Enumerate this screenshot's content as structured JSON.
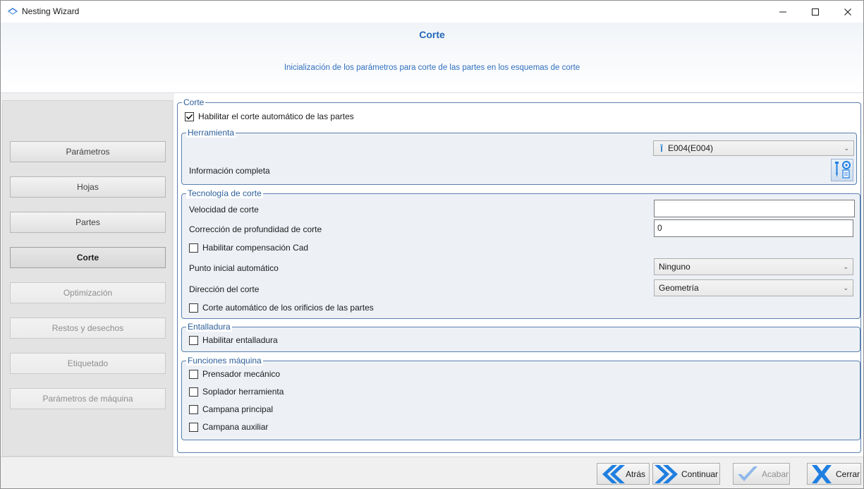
{
  "window": {
    "title": "Nesting Wizard"
  },
  "header": {
    "title": "Corte",
    "subtitle": "Inicialización de los parámetros para corte de las partes en los esquemas de corte"
  },
  "nav": {
    "items": [
      {
        "label": "Parámetros",
        "state": "enabled"
      },
      {
        "label": "Hojas",
        "state": "enabled"
      },
      {
        "label": "Partes",
        "state": "enabled"
      },
      {
        "label": "Corte",
        "state": "active"
      },
      {
        "label": "Optimización",
        "state": "disabled"
      },
      {
        "label": "Restos y desechos",
        "state": "disabled"
      },
      {
        "label": "Etiquetado",
        "state": "disabled"
      },
      {
        "label": "Parámetros de máquina",
        "state": "disabled"
      }
    ]
  },
  "corte": {
    "group_title": "Corte",
    "auto_cut_label": "Habilitar el corte automático de las partes",
    "auto_cut_checked": true
  },
  "herramienta": {
    "group_title": "Herramienta",
    "tool_value": "E004(E004)",
    "info_label": "Información completa"
  },
  "tecnologia": {
    "group_title": "Tecnología de corte",
    "speed_label": "Velocidad de corte",
    "speed_value": "",
    "depth_label": "Corrección de profundidad de corte",
    "depth_value": "0",
    "cad_comp_label": "Habilitar compensación Cad",
    "cad_comp_checked": false,
    "start_point_label": "Punto inicial automático",
    "start_point_value": "Ninguno",
    "direction_label": "Dirección del corte",
    "direction_value": "Geometría",
    "holes_label": "Corte automático de los orificios de las partes",
    "holes_checked": false
  },
  "entalladura": {
    "group_title": "Entalladura",
    "enable_label": "Habilitar entalladura",
    "enable_checked": false
  },
  "funciones": {
    "group_title": "Funciones máquina",
    "items": [
      {
        "label": "Prensador mecánico",
        "checked": false
      },
      {
        "label": "Soplador herramienta",
        "checked": false
      },
      {
        "label": "Campana principal",
        "checked": false
      },
      {
        "label": "Campana auxiliar",
        "checked": false
      }
    ]
  },
  "footer": {
    "back_label": "Atrás",
    "continue_label": "Continuar",
    "finish_label": "Acabar",
    "close_label": "Cerrar"
  },
  "colors": {
    "accent_blue": "#2467b8",
    "group_border": "#5b7fae",
    "icon_blue": "#1f7fe0"
  }
}
